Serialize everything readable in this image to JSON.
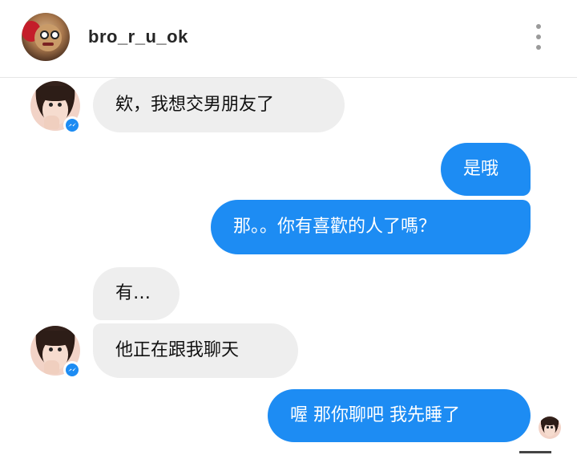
{
  "header": {
    "username": "bro_r_u_ok"
  },
  "messages": [
    {
      "side": "in",
      "text": "欸，我想交男朋友了"
    },
    {
      "side": "out",
      "text": "是哦"
    },
    {
      "side": "out",
      "text": "那。。你有喜歡的人了嗎？"
    },
    {
      "side": "in",
      "text": "有…"
    },
    {
      "side": "in",
      "text": "他正在跟我聊天"
    },
    {
      "side": "out",
      "text": "喔 那你聊吧 我先睡了"
    }
  ],
  "colors": {
    "outgoing_bubble": "#1d8cf3",
    "incoming_bubble": "#eeeeee",
    "messenger_badge": "#1d8cf3"
  },
  "icons": {
    "more": "vertical-ellipsis-icon",
    "messenger_badge": "messenger-icon"
  }
}
